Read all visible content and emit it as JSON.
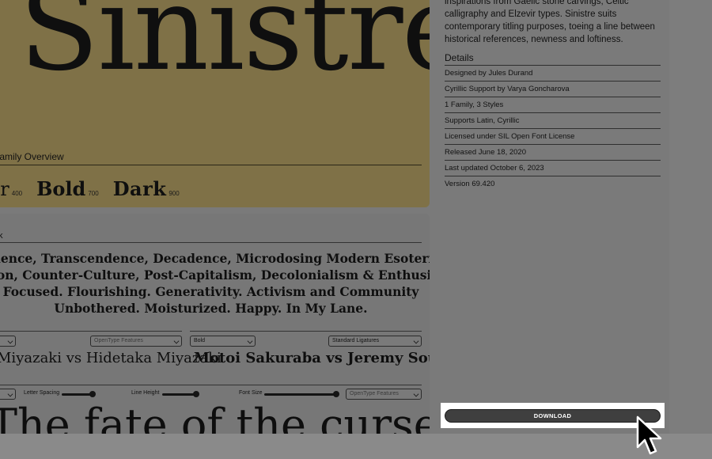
{
  "hero": {
    "title": "Sinistre",
    "overview_label": "Family Overview",
    "styles": [
      {
        "name": "Regular",
        "visible": "ar",
        "weight": "400"
      },
      {
        "name": "Bold",
        "weight": "700"
      },
      {
        "name": "Dark",
        "weight": "900"
      }
    ]
  },
  "tester": {
    "label": "k",
    "paragraph": [
      "dence, Transcendence, Decadence, Microdosing Modern Esoteric Truths",
      "ion, Counter-Culture, Post-Capitalism, Decolonialism & Enthusiasm",
      "Focused. Flourishing. Generativity. Activism and Community",
      "Unbothered. Moisturized. Happy. In My Lane."
    ],
    "left_pair": {
      "opentype_placeholder": "OpenType Features",
      "text": "Miyazaki vs Hidetaka Miyazaki"
    },
    "right_pair": {
      "style_value": "Bold",
      "feature_value": "Standard Ligatures",
      "text": "Motoi Sakuraba vs Jeremy Soule"
    },
    "controls": {
      "letter_spacing": "Letter Spacing",
      "line_height": "Line Height",
      "font_size": "Font Size",
      "opentype_placeholder": "OpenType Features"
    },
    "big_sample": "The fate of the cursed"
  },
  "description": {
    "lines": [
      "inspirations from Gaelic stone carvings, Celtic",
      "calligraphy and Elzevir types. Sinistre suits",
      "contemporary titling purposes, toeing a line between",
      "historical references, newness and loftiness."
    ]
  },
  "details": {
    "title": "Details",
    "rows": [
      "Designed by Jules Durand",
      "Cyrillic Support by Varya Goncharova",
      "1 Family, 3 Styles",
      "Supports Latin, Cyrillic",
      "Licensed under SIL Open Font License",
      "Released June 18, 2020",
      "Last updated October 6, 2023",
      "Version 69.420"
    ]
  },
  "download": {
    "label": "DOWNLOAD"
  },
  "colors": {
    "hero_gold": "#7f7147",
    "overlay_gray": "#7a7a7a",
    "button_dark": "#3f3f3f"
  }
}
